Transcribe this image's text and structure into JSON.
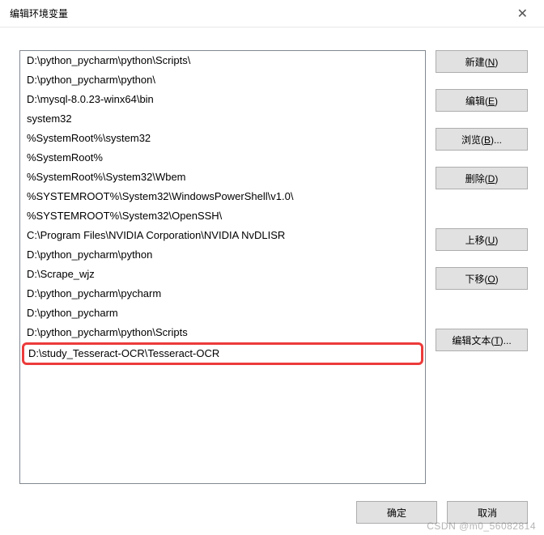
{
  "window": {
    "title": "编辑环境变量",
    "close_glyph": "✕"
  },
  "list": {
    "items": [
      "D:\\python_pycharm\\python\\Scripts\\",
      "D:\\python_pycharm\\python\\",
      "D:\\mysql-8.0.23-winx64\\bin",
      "system32",
      "%SystemRoot%\\system32",
      "%SystemRoot%",
      "%SystemRoot%\\System32\\Wbem",
      "%SYSTEMROOT%\\System32\\WindowsPowerShell\\v1.0\\",
      "%SYSTEMROOT%\\System32\\OpenSSH\\",
      "C:\\Program Files\\NVIDIA Corporation\\NVIDIA NvDLISR",
      "D:\\python_pycharm\\python",
      "D:\\Scrape_wjz",
      "D:\\python_pycharm\\pycharm",
      "D:\\python_pycharm",
      "D:\\python_pycharm\\python\\Scripts",
      "D:\\study_Tesseract-OCR\\Tesseract-OCR"
    ],
    "highlighted_index": 15
  },
  "buttons": {
    "new": "新建(N)",
    "edit": "编辑(E)",
    "browse": "浏览(B)...",
    "delete": "删除(D)",
    "move_up": "上移(U)",
    "move_down": "下移(O)",
    "edit_text": "编辑文本(T)...",
    "ok": "确定",
    "cancel": "取消"
  },
  "watermark": "CSDN @m0_56082814"
}
